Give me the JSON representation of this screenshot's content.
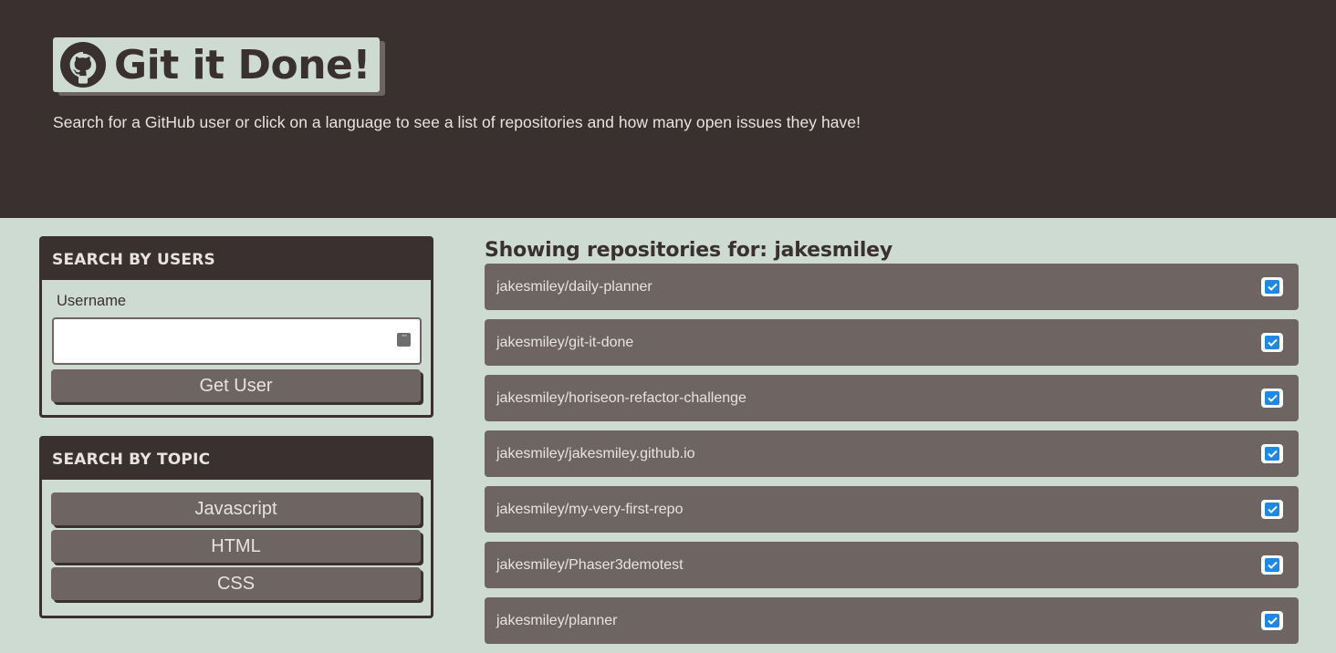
{
  "header": {
    "title": "Git it Done!",
    "tagline": "Search for a GitHub user or click on a language to see a list of repositories and how many open issues they have!"
  },
  "user_search": {
    "heading": "SEARCH BY USERS",
    "username_label": "Username",
    "username_value": "",
    "button_label": "Get User"
  },
  "topic_search": {
    "heading": "SEARCH BY TOPIC",
    "topics": [
      "Javascript",
      "HTML",
      "CSS"
    ]
  },
  "repos": {
    "heading": "Showing repositories for: jakesmiley",
    "items": [
      "jakesmiley/daily-planner",
      "jakesmiley/git-it-done",
      "jakesmiley/horiseon-refactor-challenge",
      "jakesmiley/jakesmiley.github.io",
      "jakesmiley/my-very-first-repo",
      "jakesmiley/Phaser3demotest",
      "jakesmiley/planner"
    ]
  },
  "colors": {
    "dark": "#3a3030",
    "mid": "#6e6563",
    "light": "#cddbd3",
    "check": "#1e88e5"
  },
  "icons": {
    "brand": "github-icon",
    "status": "check-icon"
  }
}
